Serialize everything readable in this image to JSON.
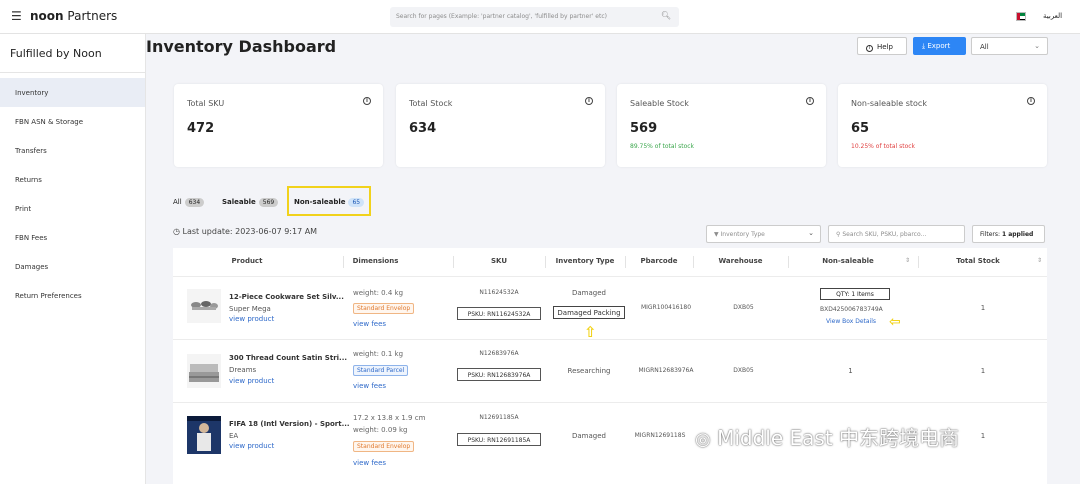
{
  "topbar": {
    "brand_bold": "noon",
    "brand_rest": " Partners",
    "search_placeholder": "Search for pages (Example: 'partner catalog', 'fulfilled by partner' etc)",
    "language": "العربية"
  },
  "sidebar": {
    "title": "Fulfilled by Noon",
    "items": [
      {
        "label": "Inventory",
        "active": true
      },
      {
        "label": "FBN ASN & Storage"
      },
      {
        "label": "Transfers"
      },
      {
        "label": "Returns"
      },
      {
        "label": "Print"
      },
      {
        "label": "FBN Fees"
      },
      {
        "label": "Damages"
      },
      {
        "label": "Return Preferences"
      }
    ]
  },
  "header": {
    "title": "Inventory Dashboard",
    "help_label": "Help",
    "export_label": "Export",
    "select_value": "All"
  },
  "cards": [
    {
      "title": "Total SKU",
      "value": "472",
      "sub": ""
    },
    {
      "title": "Total Stock",
      "value": "634",
      "sub": ""
    },
    {
      "title": "Saleable Stock",
      "value": "569",
      "sub": "89.75% of total stock",
      "sub_color": "#3aa64b"
    },
    {
      "title": "Non-saleable stock",
      "value": "65",
      "sub": "10.25% of total stock",
      "sub_color": "#e04040"
    }
  ],
  "tabs": [
    {
      "label": "All",
      "count": "634"
    },
    {
      "label": "Saleable",
      "count": "569"
    },
    {
      "label": "Non-saleable",
      "count": "65"
    }
  ],
  "toolbar": {
    "last_update": "Last update: 2023-06-07 9:17 AM",
    "inventory_type_placeholder": "Inventory Type",
    "search_placeholder": "Search SKU, PSKU, pbarco...",
    "filters_label": "Filters:",
    "filters_value": "1 applied"
  },
  "table": {
    "columns": [
      "Product",
      "Dimensions",
      "SKU",
      "Inventory Type",
      "Pbarcode",
      "Warehouse",
      "Non-saleable",
      "Total Stock"
    ],
    "rows": [
      {
        "name": "12-Piece Cookware Set Silv...",
        "brand": "Super Mega",
        "link": "view product",
        "dims": "",
        "weight": "weight: 0.4 kg",
        "pill": "Standard Envelop",
        "fees": "view fees",
        "sku": "N11624532A",
        "psku": "PSKU: RN11624532A",
        "inv_type": "Damaged",
        "inv_type_sub": "Damaged Packing",
        "pbarcode": "MIGR100416180",
        "warehouse": "DXB05",
        "qty": "QTY: 1 Items",
        "box_id": "BXD425006783749A",
        "box_link": "View Box Details",
        "nonsaleable": "",
        "total": "1"
      },
      {
        "name": "300 Thread Count Satin Stri...",
        "brand": "Dreams",
        "link": "view product",
        "dims": "",
        "weight": "weight: 0.1 kg",
        "pill": "Standard Parcel",
        "fees": "view fees",
        "sku": "N12683976A",
        "psku": "PSKU: RN12683976A",
        "inv_type": "Researching",
        "pbarcode": "MIGRN12683976A",
        "warehouse": "DXB05",
        "nonsaleable": "1",
        "total": "1"
      },
      {
        "name": "FIFA 18 (Intl Version) - Sport...",
        "brand": "EA",
        "link": "view product",
        "dims": "17.2 x 13.8 x 1.9 cm",
        "weight": "weight: 0.09 kg",
        "pill": "Standard Envelop",
        "fees": "view fees",
        "sku": "N12691185A",
        "psku": "PSKU: RN12691185A",
        "inv_type": "Damaged",
        "pbarcode": "MIGRN1269118S",
        "warehouse": "",
        "nonsaleable": "",
        "total": "1"
      }
    ]
  },
  "watermark": "Middle East 中东跨境电商"
}
